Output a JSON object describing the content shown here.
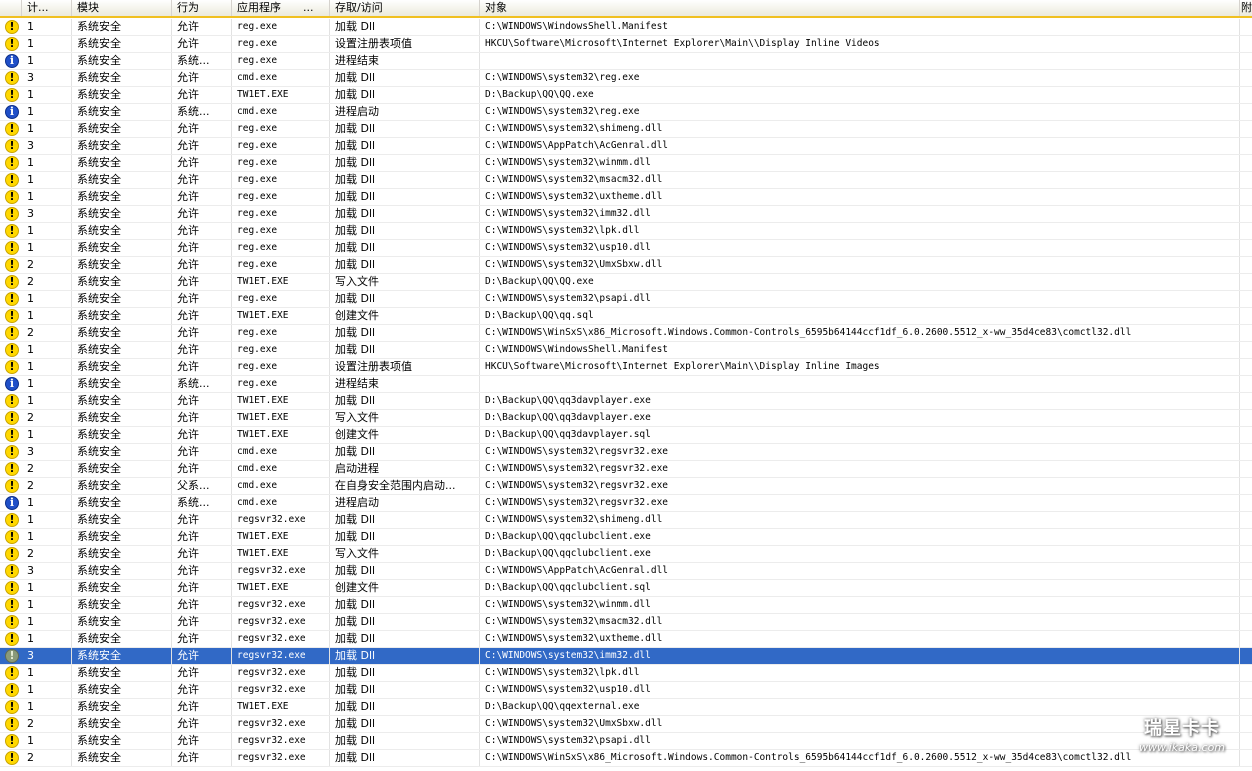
{
  "columns": [
    {
      "key": "icon",
      "label": ""
    },
    {
      "key": "count",
      "label": "计..."
    },
    {
      "key": "module",
      "label": "模块"
    },
    {
      "key": "action",
      "label": "行为"
    },
    {
      "key": "app",
      "label": "应用程序"
    },
    {
      "key": "app_more",
      "label": "..."
    },
    {
      "key": "access",
      "label": "存取/访问"
    },
    {
      "key": "target",
      "label": "对象"
    },
    {
      "key": "extra",
      "label": "附"
    }
  ],
  "rows": [
    {
      "icon": "warning-icon",
      "count": "1",
      "module": "系统安全",
      "action": "允许",
      "app": "reg.exe",
      "access": "加载 Dll",
      "target": "C:\\WINDOWS\\WindowsShell.Manifest"
    },
    {
      "icon": "warning-icon",
      "count": "1",
      "module": "系统安全",
      "action": "允许",
      "app": "reg.exe",
      "access": "设置注册表项值",
      "target": "HKCU\\Software\\Microsoft\\Internet Explorer\\Main\\\\Display Inline Videos"
    },
    {
      "icon": "info-icon",
      "count": "1",
      "module": "系统安全",
      "action": "系统...",
      "app": "reg.exe",
      "access": "进程结束",
      "target": ""
    },
    {
      "icon": "warning-icon",
      "count": "3",
      "module": "系统安全",
      "action": "允许",
      "app": "cmd.exe",
      "access": "加载 Dll",
      "target": "C:\\WINDOWS\\system32\\reg.exe"
    },
    {
      "icon": "warning-icon",
      "count": "1",
      "module": "系统安全",
      "action": "允许",
      "app": "TW1ET.EXE",
      "access": "加载 Dll",
      "target": "D:\\Backup\\QQ\\QQ.exe"
    },
    {
      "icon": "info-icon",
      "count": "1",
      "module": "系统安全",
      "action": "系统...",
      "app": "cmd.exe",
      "access": "进程启动",
      "target": "C:\\WINDOWS\\system32\\reg.exe"
    },
    {
      "icon": "warning-icon",
      "count": "1",
      "module": "系统安全",
      "action": "允许",
      "app": "reg.exe",
      "access": "加载 Dll",
      "target": "C:\\WINDOWS\\system32\\shimeng.dll"
    },
    {
      "icon": "warning-icon",
      "count": "3",
      "module": "系统安全",
      "action": "允许",
      "app": "reg.exe",
      "access": "加载 Dll",
      "target": "C:\\WINDOWS\\AppPatch\\AcGenral.dll"
    },
    {
      "icon": "warning-icon",
      "count": "1",
      "module": "系统安全",
      "action": "允许",
      "app": "reg.exe",
      "access": "加载 Dll",
      "target": "C:\\WINDOWS\\system32\\winmm.dll"
    },
    {
      "icon": "warning-icon",
      "count": "1",
      "module": "系统安全",
      "action": "允许",
      "app": "reg.exe",
      "access": "加载 Dll",
      "target": "C:\\WINDOWS\\system32\\msacm32.dll"
    },
    {
      "icon": "warning-icon",
      "count": "1",
      "module": "系统安全",
      "action": "允许",
      "app": "reg.exe",
      "access": "加载 Dll",
      "target": "C:\\WINDOWS\\system32\\uxtheme.dll"
    },
    {
      "icon": "warning-icon",
      "count": "3",
      "module": "系统安全",
      "action": "允许",
      "app": "reg.exe",
      "access": "加载 Dll",
      "target": "C:\\WINDOWS\\system32\\imm32.dll"
    },
    {
      "icon": "warning-icon",
      "count": "1",
      "module": "系统安全",
      "action": "允许",
      "app": "reg.exe",
      "access": "加载 Dll",
      "target": "C:\\WINDOWS\\system32\\lpk.dll"
    },
    {
      "icon": "warning-icon",
      "count": "1",
      "module": "系统安全",
      "action": "允许",
      "app": "reg.exe",
      "access": "加载 Dll",
      "target": "C:\\WINDOWS\\system32\\usp10.dll"
    },
    {
      "icon": "warning-icon",
      "count": "2",
      "module": "系统安全",
      "action": "允许",
      "app": "reg.exe",
      "access": "加载 Dll",
      "target": "C:\\WINDOWS\\system32\\UmxSbxw.dll"
    },
    {
      "icon": "warning-icon",
      "count": "2",
      "module": "系统安全",
      "action": "允许",
      "app": "TW1ET.EXE",
      "access": "写入文件",
      "target": "D:\\Backup\\QQ\\QQ.exe"
    },
    {
      "icon": "warning-icon",
      "count": "1",
      "module": "系统安全",
      "action": "允许",
      "app": "reg.exe",
      "access": "加载 Dll",
      "target": "C:\\WINDOWS\\system32\\psapi.dll"
    },
    {
      "icon": "warning-icon",
      "count": "1",
      "module": "系统安全",
      "action": "允许",
      "app": "TW1ET.EXE",
      "access": "创建文件",
      "target": "D:\\Backup\\QQ\\qq.sql"
    },
    {
      "icon": "warning-icon",
      "count": "2",
      "module": "系统安全",
      "action": "允许",
      "app": "reg.exe",
      "access": "加载 Dll",
      "target": "C:\\WINDOWS\\WinSxS\\x86_Microsoft.Windows.Common-Controls_6595b64144ccf1df_6.0.2600.5512_x-ww_35d4ce83\\comctl32.dll"
    },
    {
      "icon": "warning-icon",
      "count": "1",
      "module": "系统安全",
      "action": "允许",
      "app": "reg.exe",
      "access": "加载 Dll",
      "target": "C:\\WINDOWS\\WindowsShell.Manifest"
    },
    {
      "icon": "warning-icon",
      "count": "1",
      "module": "系统安全",
      "action": "允许",
      "app": "reg.exe",
      "access": "设置注册表项值",
      "target": "HKCU\\Software\\Microsoft\\Internet Explorer\\Main\\\\Display Inline Images"
    },
    {
      "icon": "info-icon",
      "count": "1",
      "module": "系统安全",
      "action": "系统...",
      "app": "reg.exe",
      "access": "进程结束",
      "target": ""
    },
    {
      "icon": "warning-icon",
      "count": "1",
      "module": "系统安全",
      "action": "允许",
      "app": "TW1ET.EXE",
      "access": "加载 Dll",
      "target": "D:\\Backup\\QQ\\qq3davplayer.exe"
    },
    {
      "icon": "warning-icon",
      "count": "2",
      "module": "系统安全",
      "action": "允许",
      "app": "TW1ET.EXE",
      "access": "写入文件",
      "target": "D:\\Backup\\QQ\\qq3davplayer.exe"
    },
    {
      "icon": "warning-icon",
      "count": "1",
      "module": "系统安全",
      "action": "允许",
      "app": "TW1ET.EXE",
      "access": "创建文件",
      "target": "D:\\Backup\\QQ\\qq3davplayer.sql"
    },
    {
      "icon": "warning-icon",
      "count": "3",
      "module": "系统安全",
      "action": "允许",
      "app": "cmd.exe",
      "access": "加载 Dll",
      "target": "C:\\WINDOWS\\system32\\regsvr32.exe"
    },
    {
      "icon": "warning-icon",
      "count": "2",
      "module": "系统安全",
      "action": "允许",
      "app": "cmd.exe",
      "access": "启动进程",
      "target": "C:\\WINDOWS\\system32\\regsvr32.exe"
    },
    {
      "icon": "warning-icon",
      "count": "2",
      "module": "系统安全",
      "action": "父系...",
      "app": "cmd.exe",
      "access": "在自身安全范围内启动...",
      "target": "C:\\WINDOWS\\system32\\regsvr32.exe"
    },
    {
      "icon": "info-icon",
      "count": "1",
      "module": "系统安全",
      "action": "系统...",
      "app": "cmd.exe",
      "access": "进程启动",
      "target": "C:\\WINDOWS\\system32\\regsvr32.exe"
    },
    {
      "icon": "warning-icon",
      "count": "1",
      "module": "系统安全",
      "action": "允许",
      "app": "regsvr32.exe",
      "access": "加载 Dll",
      "target": "C:\\WINDOWS\\system32\\shimeng.dll"
    },
    {
      "icon": "warning-icon",
      "count": "1",
      "module": "系统安全",
      "action": "允许",
      "app": "TW1ET.EXE",
      "access": "加载 Dll",
      "target": "D:\\Backup\\QQ\\qqclubclient.exe"
    },
    {
      "icon": "warning-icon",
      "count": "2",
      "module": "系统安全",
      "action": "允许",
      "app": "TW1ET.EXE",
      "access": "写入文件",
      "target": "D:\\Backup\\QQ\\qqclubclient.exe"
    },
    {
      "icon": "warning-icon",
      "count": "3",
      "module": "系统安全",
      "action": "允许",
      "app": "regsvr32.exe",
      "access": "加载 Dll",
      "target": "C:\\WINDOWS\\AppPatch\\AcGenral.dll"
    },
    {
      "icon": "warning-icon",
      "count": "1",
      "module": "系统安全",
      "action": "允许",
      "app": "TW1ET.EXE",
      "access": "创建文件",
      "target": "D:\\Backup\\QQ\\qqclubclient.sql"
    },
    {
      "icon": "warning-icon",
      "count": "1",
      "module": "系统安全",
      "action": "允许",
      "app": "regsvr32.exe",
      "access": "加载 Dll",
      "target": "C:\\WINDOWS\\system32\\winmm.dll"
    },
    {
      "icon": "warning-icon",
      "count": "1",
      "module": "系统安全",
      "action": "允许",
      "app": "regsvr32.exe",
      "access": "加载 Dll",
      "target": "C:\\WINDOWS\\system32\\msacm32.dll"
    },
    {
      "icon": "warning-icon",
      "count": "1",
      "module": "系统安全",
      "action": "允许",
      "app": "regsvr32.exe",
      "access": "加载 Dll",
      "target": "C:\\WINDOWS\\system32\\uxtheme.dll"
    },
    {
      "icon": "warning-icon",
      "count": "3",
      "module": "系统安全",
      "action": "允许",
      "app": "regsvr32.exe",
      "access": "加载 Dll",
      "target": "C:\\WINDOWS\\system32\\imm32.dll",
      "selected": true
    },
    {
      "icon": "warning-icon",
      "count": "1",
      "module": "系统安全",
      "action": "允许",
      "app": "regsvr32.exe",
      "access": "加载 Dll",
      "target": "C:\\WINDOWS\\system32\\lpk.dll"
    },
    {
      "icon": "warning-icon",
      "count": "1",
      "module": "系统安全",
      "action": "允许",
      "app": "regsvr32.exe",
      "access": "加载 Dll",
      "target": "C:\\WINDOWS\\system32\\usp10.dll"
    },
    {
      "icon": "warning-icon",
      "count": "1",
      "module": "系统安全",
      "action": "允许",
      "app": "TW1ET.EXE",
      "access": "加载 Dll",
      "target": "D:\\Backup\\QQ\\qqexternal.exe"
    },
    {
      "icon": "warning-icon",
      "count": "2",
      "module": "系统安全",
      "action": "允许",
      "app": "regsvr32.exe",
      "access": "加载 Dll",
      "target": "C:\\WINDOWS\\system32\\UmxSbxw.dll"
    },
    {
      "icon": "warning-icon",
      "count": "1",
      "module": "系统安全",
      "action": "允许",
      "app": "regsvr32.exe",
      "access": "加载 Dll",
      "target": "C:\\WINDOWS\\system32\\psapi.dll"
    },
    {
      "icon": "warning-icon",
      "count": "2",
      "module": "系统安全",
      "action": "允许",
      "app": "regsvr32.exe",
      "access": "加载 Dll",
      "target": "C:\\WINDOWS\\WinSxS\\x86_Microsoft.Windows.Common-Controls_6595b64144ccf1df_6.0.2600.5512_x-ww_35d4ce83\\comctl32.dll"
    }
  ],
  "watermark": {
    "line1": "瑞星卡卡",
    "line2": "www.ikaka.com"
  },
  "colors": {
    "selection": "#3169c6",
    "header_underline": "#f0c020",
    "warning": "#ffd800",
    "info": "#1f4fc8"
  }
}
